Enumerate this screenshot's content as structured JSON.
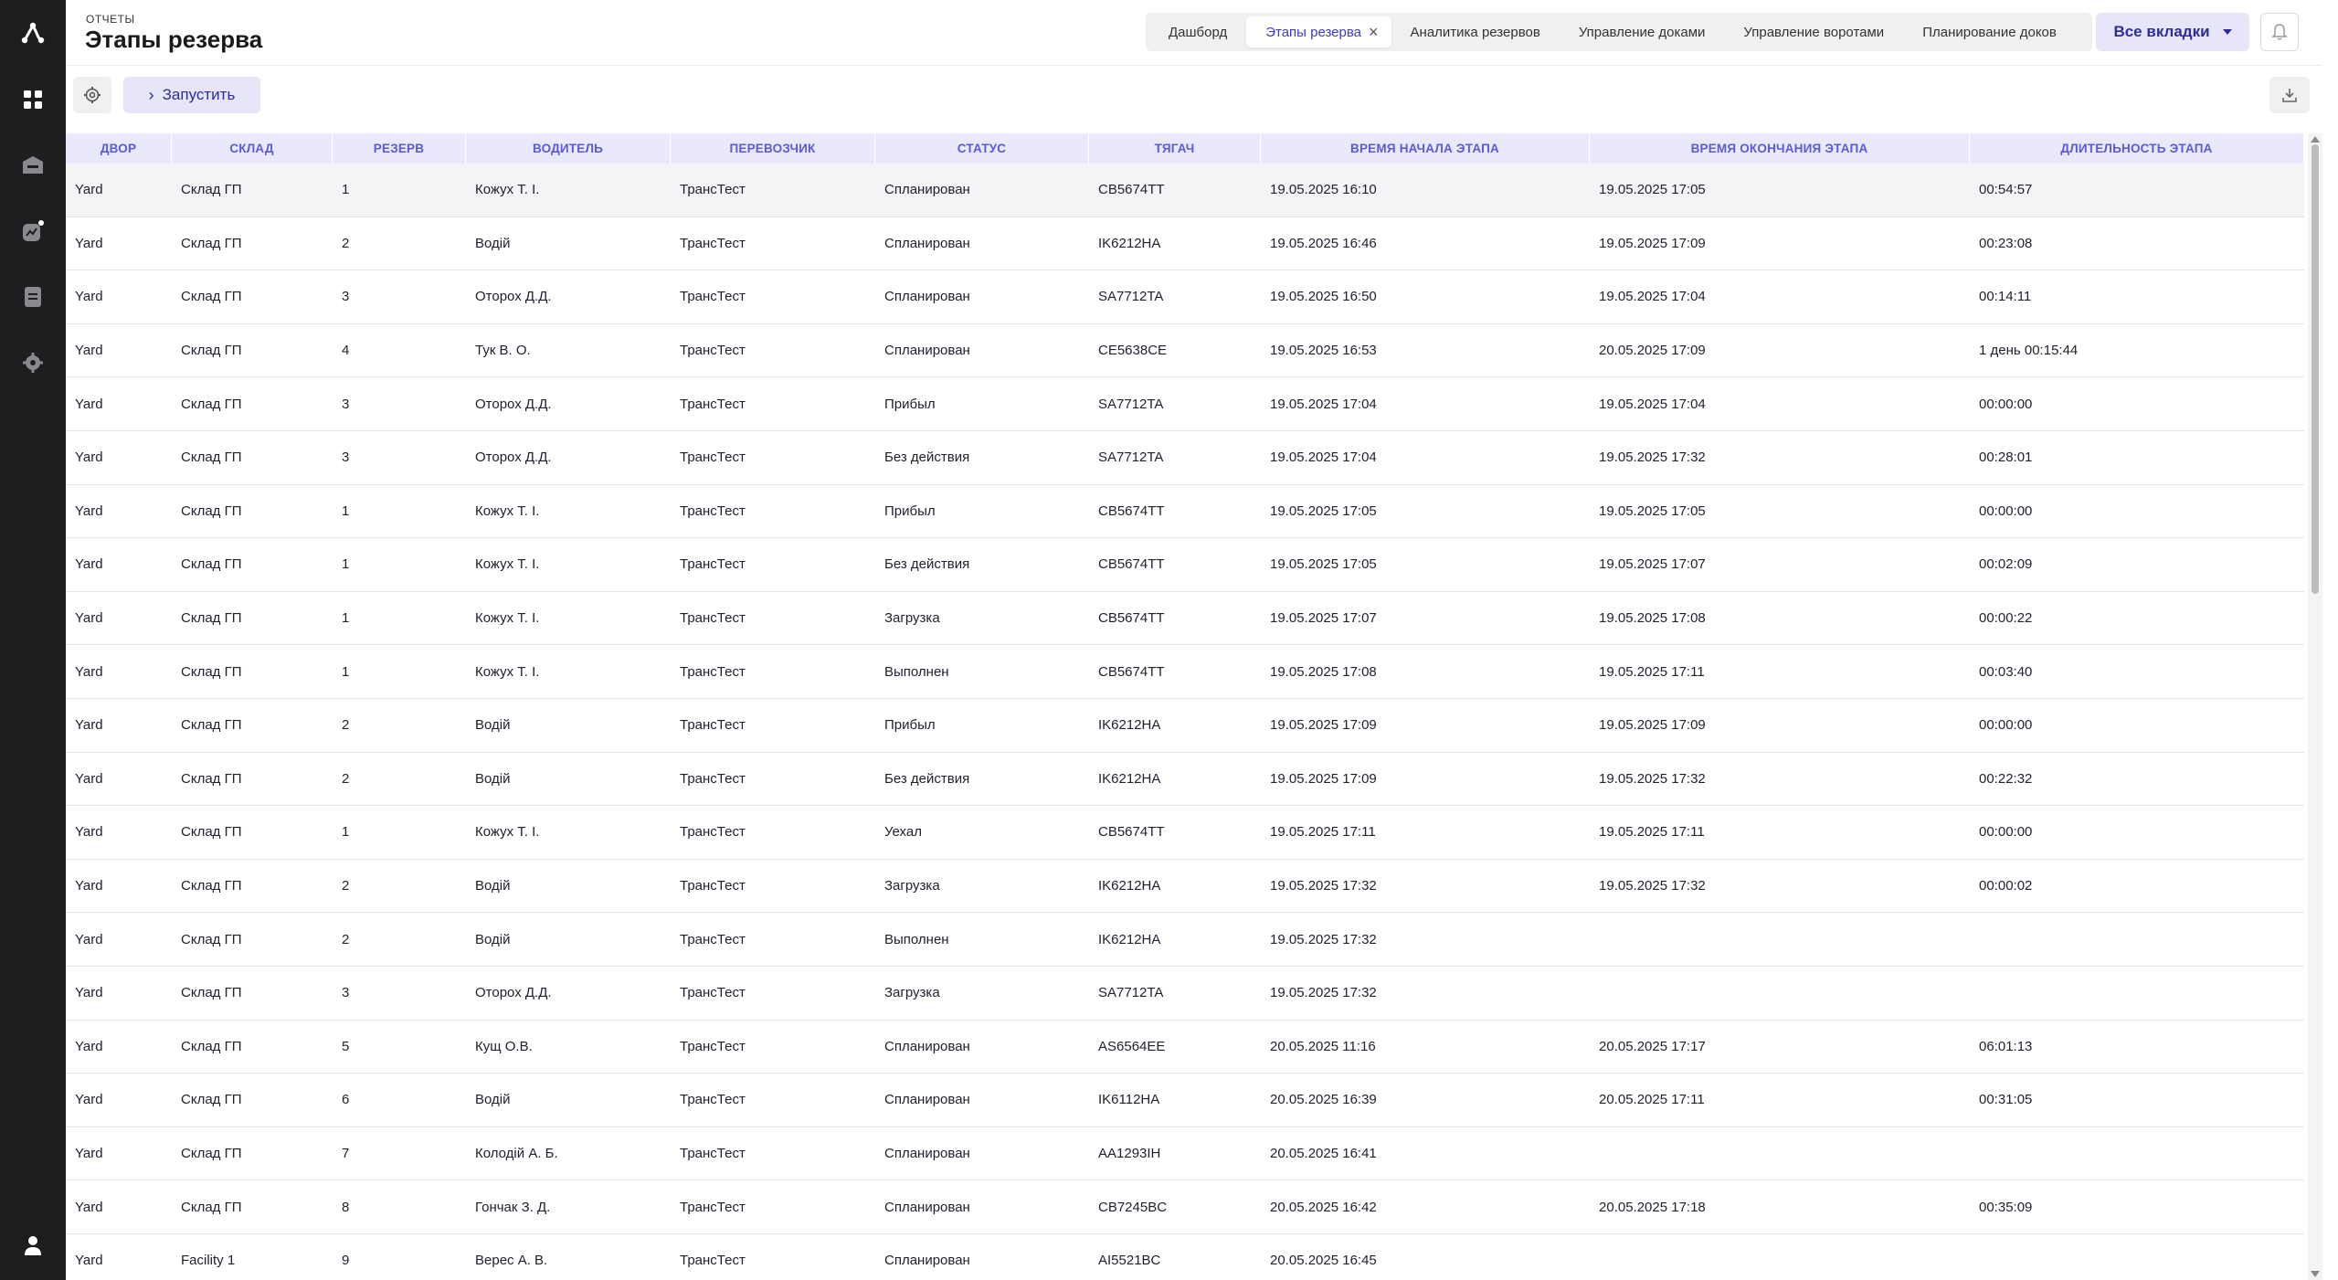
{
  "header": {
    "breadcrumb": "ОТЧЕТЫ",
    "title": "Этапы резерва"
  },
  "tabs": [
    {
      "label": "Дашборд"
    },
    {
      "label": "Этапы резерва"
    },
    {
      "label": "Аналитика резервов"
    },
    {
      "label": "Управление доками"
    },
    {
      "label": "Управление воротами"
    },
    {
      "label": "Планирование доков"
    }
  ],
  "all_tabs_label": "Все вкладки",
  "toolbar": {
    "run_label": "Запустить"
  },
  "accent_color": "#5b5bd6",
  "table": {
    "columns": [
      "ДВОР",
      "СКЛАД",
      "РЕЗЕРВ",
      "ВОДИТЕЛЬ",
      "ПЕРЕВОЗЧИК",
      "СТАТУС",
      "ТЯГАЧ",
      "ВРЕМЯ НАЧАЛА ЭТАПА",
      "ВРЕМЯ ОКОНЧАНИЯ ЭТАПА",
      "ДЛИТЕЛЬНОСТЬ ЭТАПА"
    ],
    "rows": [
      [
        "Yard",
        "Склад ГП",
        "1",
        "Кожух Т. І.",
        "ТрансТест",
        "Спланирован",
        "CB5674TT",
        "19.05.2025 16:10",
        "19.05.2025 17:05",
        "00:54:57"
      ],
      [
        "Yard",
        "Склад ГП",
        "2",
        "Водій",
        "ТрансТест",
        "Спланирован",
        "IK6212HA",
        "19.05.2025 16:46",
        "19.05.2025 17:09",
        "00:23:08"
      ],
      [
        "Yard",
        "Склад ГП",
        "3",
        "Оторох Д.Д.",
        "ТрансТест",
        "Спланирован",
        "SA7712TA",
        "19.05.2025 16:50",
        "19.05.2025 17:04",
        "00:14:11"
      ],
      [
        "Yard",
        "Склад ГП",
        "4",
        "Тук В. О.",
        "ТрансТест",
        "Спланирован",
        "CE5638CE",
        "19.05.2025 16:53",
        "20.05.2025 17:09",
        "1 день 00:15:44"
      ],
      [
        "Yard",
        "Склад ГП",
        "3",
        "Оторох Д.Д.",
        "ТрансТест",
        "Прибыл",
        "SA7712TA",
        "19.05.2025 17:04",
        "19.05.2025 17:04",
        "00:00:00"
      ],
      [
        "Yard",
        "Склад ГП",
        "3",
        "Оторох Д.Д.",
        "ТрансТест",
        "Без действия",
        "SA7712TA",
        "19.05.2025 17:04",
        "19.05.2025 17:32",
        "00:28:01"
      ],
      [
        "Yard",
        "Склад ГП",
        "1",
        "Кожух Т. І.",
        "ТрансТест",
        "Прибыл",
        "CB5674TT",
        "19.05.2025 17:05",
        "19.05.2025 17:05",
        "00:00:00"
      ],
      [
        "Yard",
        "Склад ГП",
        "1",
        "Кожух Т. І.",
        "ТрансТест",
        "Без действия",
        "CB5674TT",
        "19.05.2025 17:05",
        "19.05.2025 17:07",
        "00:02:09"
      ],
      [
        "Yard",
        "Склад ГП",
        "1",
        "Кожух Т. І.",
        "ТрансТест",
        "Загрузка",
        "CB5674TT",
        "19.05.2025 17:07",
        "19.05.2025 17:08",
        "00:00:22"
      ],
      [
        "Yard",
        "Склад ГП",
        "1",
        "Кожух Т. І.",
        "ТрансТест",
        "Выполнен",
        "CB5674TT",
        "19.05.2025 17:08",
        "19.05.2025 17:11",
        "00:03:40"
      ],
      [
        "Yard",
        "Склад ГП",
        "2",
        "Водій",
        "ТрансТест",
        "Прибыл",
        "IK6212HA",
        "19.05.2025 17:09",
        "19.05.2025 17:09",
        "00:00:00"
      ],
      [
        "Yard",
        "Склад ГП",
        "2",
        "Водій",
        "ТрансТест",
        "Без действия",
        "IK6212HA",
        "19.05.2025 17:09",
        "19.05.2025 17:32",
        "00:22:32"
      ],
      [
        "Yard",
        "Склад ГП",
        "1",
        "Кожух Т. І.",
        "ТрансТест",
        "Уехал",
        "CB5674TT",
        "19.05.2025 17:11",
        "19.05.2025 17:11",
        "00:00:00"
      ],
      [
        "Yard",
        "Склад ГП",
        "2",
        "Водій",
        "ТрансТест",
        "Загрузка",
        "IK6212HA",
        "19.05.2025 17:32",
        "19.05.2025 17:32",
        "00:00:02"
      ],
      [
        "Yard",
        "Склад ГП",
        "2",
        "Водій",
        "ТрансТест",
        "Выполнен",
        "IK6212HA",
        "19.05.2025 17:32",
        "",
        ""
      ],
      [
        "Yard",
        "Склад ГП",
        "3",
        "Оторох Д.Д.",
        "ТрансТест",
        "Загрузка",
        "SA7712TA",
        "19.05.2025 17:32",
        "",
        ""
      ],
      [
        "Yard",
        "Склад ГП",
        "5",
        "Кущ О.В.",
        "ТрансТест",
        "Спланирован",
        "AS6564EE",
        "20.05.2025 11:16",
        "20.05.2025 17:17",
        "06:01:13"
      ],
      [
        "Yard",
        "Склад ГП",
        "6",
        "Водій",
        "ТрансТест",
        "Спланирован",
        "IK6112HA",
        "20.05.2025 16:39",
        "20.05.2025 17:11",
        "00:31:05"
      ],
      [
        "Yard",
        "Склад ГП",
        "7",
        "Колодій А. Б.",
        "ТрансТест",
        "Спланирован",
        "AA1293IH",
        "20.05.2025 16:41",
        "",
        ""
      ],
      [
        "Yard",
        "Склад ГП",
        "8",
        "Гончак З. Д.",
        "ТрансТест",
        "Спланирован",
        "CB7245BC",
        "20.05.2025 16:42",
        "20.05.2025 17:18",
        "00:35:09"
      ],
      [
        "Yard",
        "Facility 1",
        "9",
        "Верес А. В.",
        "ТрансТест",
        "Спланирован",
        "AI5521BC",
        "20.05.2025 16:45",
        "",
        ""
      ]
    ]
  }
}
